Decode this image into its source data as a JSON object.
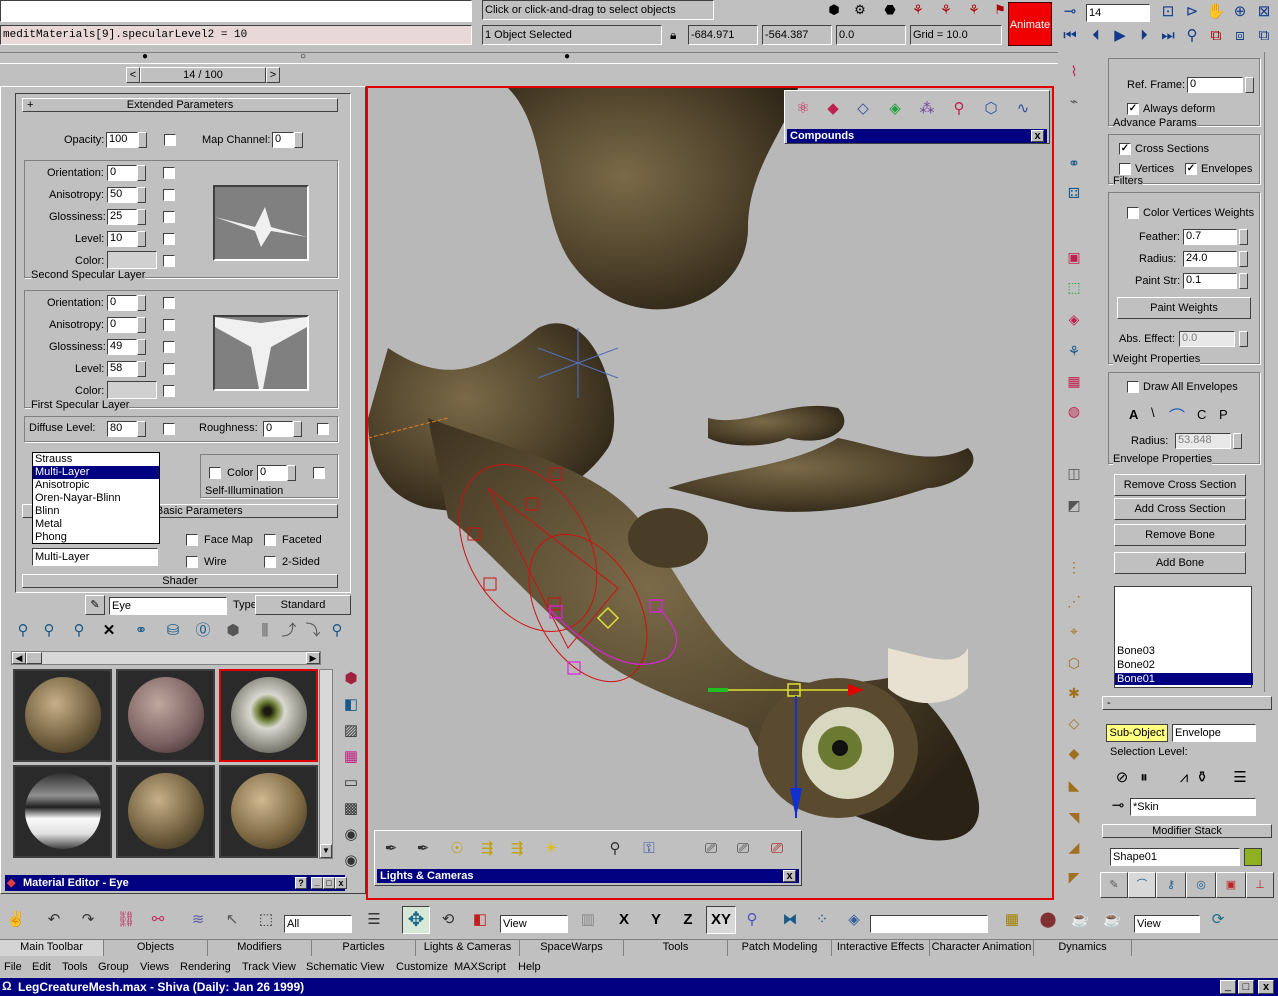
{
  "titlebar": {
    "title": "LegCreatureMesh.max - Shiva (Daily: Jan 26 1999)",
    "app_icon": "max-logo-icon",
    "controls": [
      "_",
      "□",
      "X"
    ],
    "color": "#000080"
  },
  "menubar": [
    "File",
    "Edit",
    "Tools",
    "Group",
    "Views",
    "Rendering",
    "Track View",
    "Schematic View",
    "Customize",
    "MAXScript",
    "Help"
  ],
  "tab_panel": [
    "Main Toolbar",
    "Objects",
    "Modifiers",
    "Particles",
    "Lights & Cameras",
    "SpaceWarps",
    "Tools",
    "Patch Modeling",
    "Interactive Effects",
    "Character Animation",
    "Dynamics"
  ],
  "main_toolbar": {
    "selection_filter": "All",
    "ref_coord": "View",
    "axis_labels": [
      "X",
      "Y",
      "Z",
      "XY"
    ],
    "named_selection": "",
    "view_dropdown": "View"
  },
  "script_listener": {
    "line1": "",
    "line2": "meditMaterials[9].specularLevel2 = 10"
  },
  "prompt": {
    "message": "Click or click-and-drag to select objects",
    "selected": "1 Object Selected",
    "x": "-684.971",
    "y": "-564.387",
    "z": "0.0",
    "grid": "Grid = 10.0",
    "animate": "Animate",
    "frame": "14"
  },
  "timeslider": {
    "label": "14 / 100"
  },
  "material_editor": {
    "title": "Material Editor - Eye",
    "rollout_extended": "Extended Parameters",
    "opacity_label": "Opacity:",
    "opacity": "100",
    "map_channel_label": "Map Channel:",
    "map_channel": "0",
    "second_layer": {
      "title": "Second Specular Layer",
      "orientation_label": "Orientation:",
      "orientation": "0",
      "anisotropy_label": "Anisotropy:",
      "anisotropy": "50",
      "glossiness_label": "Glossiness:",
      "glossiness": "25",
      "level_label": "Level:",
      "level": "10",
      "color_label": "Color:"
    },
    "first_layer": {
      "title": "First Specular Layer",
      "orientation_label": "Orientation:",
      "orientation": "0",
      "anisotropy_label": "Anisotropy:",
      "anisotropy": "0",
      "glossiness_label": "Glossiness:",
      "glossiness": "49",
      "level_label": "Level:",
      "level": "58",
      "color_label": "Color:"
    },
    "diffuse_level_label": "Diffuse Level:",
    "diffuse_level": "80",
    "roughness_label": "Roughness:",
    "roughness": "0",
    "self_illum_title": "Self-Illumination",
    "self_illum_color_label": "Color",
    "self_illum_value": "0",
    "shader_basic_title": "Shader Basic Parameters",
    "shader_list": [
      "Strauss",
      "Multi-Layer",
      "Anisotropic",
      "Oren-Nayar-Blinn",
      "Blinn",
      "Metal",
      "Phong"
    ],
    "shader_selected": "Multi-Layer",
    "face_map": "Face Map",
    "faceted": "Faceted",
    "wire": "Wire",
    "two_sided": "2-Sided",
    "shader_rollout": "Shader",
    "material_name": "Eye",
    "type_label": "Type:",
    "type_value": "Standard"
  },
  "compounds_toolbar": {
    "title": "Compounds"
  },
  "lights_toolbar": {
    "title": "Lights & Cameras"
  },
  "command_panel": {
    "object_name": "Shape01",
    "object_color": "#8fb020",
    "modifier_stack_title": "Modifier Stack",
    "modifier": "*Skin",
    "selection_level_label": "Selection Level:",
    "sub_object": "Sub-Object",
    "sub_object_level": "Envelope",
    "bones": [
      "Bone01",
      "Bone02",
      "Bone03"
    ],
    "add_bone": "Add Bone",
    "remove_bone": "Remove Bone",
    "add_cross": "Add Cross Section",
    "remove_cross": "Remove Cross Section",
    "env_props_title": "Envelope Properties",
    "radius_label": "Radius:",
    "radius": "53.848",
    "draw_all": "Draw All Envelopes",
    "weight_props_title": "Weight Properties",
    "abs_effect_label": "Abs. Effect:",
    "abs_effect": "0.0",
    "paint_weights": "Paint Weights",
    "paint_str_label": "Paint Str:",
    "paint_str": "0.1",
    "paint_radius_label": "Radius:",
    "paint_radius": "24.0",
    "feather_label": "Feather:",
    "feather": "0.7",
    "color_vertices": "Color Vertices Weights",
    "filters_title": "Filters",
    "vertices": "Vertices",
    "envelopes": "Envelopes",
    "cross_sections": "Cross Sections",
    "advance_title": "Advance Params",
    "always_deform": "Always deform",
    "ref_frame_label": "Ref. Frame:",
    "ref_frame": "0"
  }
}
